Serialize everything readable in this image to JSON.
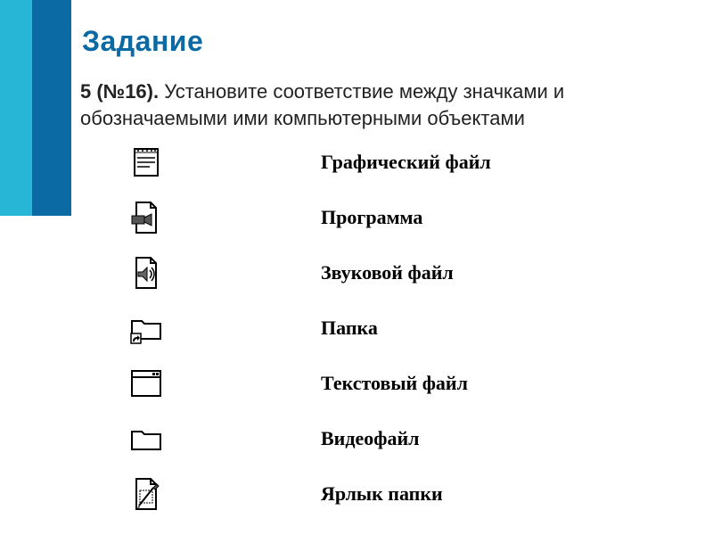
{
  "heading": "Задание",
  "prompt": {
    "bold": "5 (№16).",
    "rest": " Установите соответствие между значками и обозначаемыми ими компьютерными объектами"
  },
  "icons": [
    {
      "name": "notepad-icon"
    },
    {
      "name": "video-file-icon"
    },
    {
      "name": "sound-file-icon"
    },
    {
      "name": "folder-shortcut-icon"
    },
    {
      "name": "window-icon"
    },
    {
      "name": "folder-icon"
    },
    {
      "name": "image-file-icon"
    }
  ],
  "labels": [
    "Графический файл",
    "Программа",
    "Звуковой файл",
    "Папка",
    "Текстовый файл",
    "Видеофайл",
    "Ярлык папки"
  ]
}
